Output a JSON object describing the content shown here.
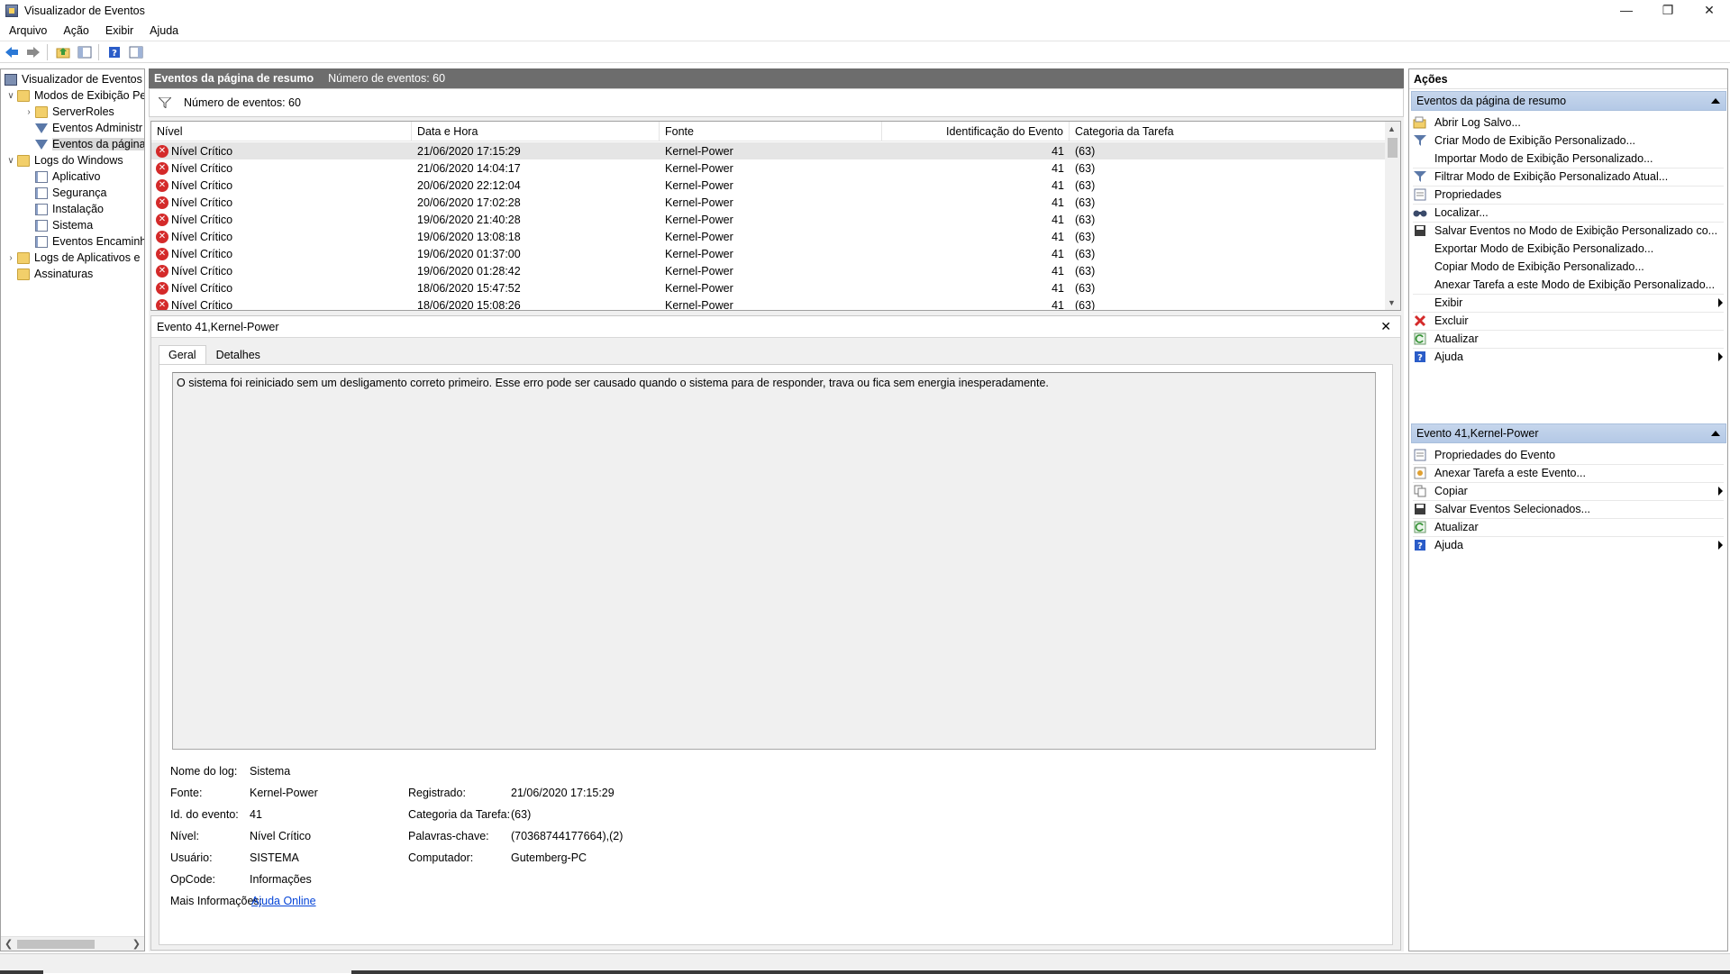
{
  "window": {
    "title": "Visualizador de Eventos",
    "controls": [
      "minimize",
      "restore",
      "close"
    ]
  },
  "menu": [
    "Arquivo",
    "Ação",
    "Exibir",
    "Ajuda"
  ],
  "toolbar": [
    "back-icon",
    "forward-icon",
    "up-folder-icon",
    "show-hide-tree-icon",
    "help-icon",
    "show-hide-action-pane-icon"
  ],
  "tree": {
    "items": [
      {
        "label": "Visualizador de Eventos (L",
        "icon": "viewer-icon"
      },
      {
        "label": "Modos de Exibição Pe",
        "icon": "folder-icon"
      },
      {
        "label": "ServerRoles",
        "icon": "folder-icon"
      },
      {
        "label": "Eventos Administr",
        "icon": "filter-icon"
      },
      {
        "label": "Eventos da página",
        "icon": "filter-icon"
      },
      {
        "label": "Logs do Windows",
        "icon": "folder-icon"
      },
      {
        "label": "Aplicativo",
        "icon": "log-icon"
      },
      {
        "label": "Segurança",
        "icon": "log-icon"
      },
      {
        "label": "Instalação",
        "icon": "log-icon"
      },
      {
        "label": "Sistema",
        "icon": "log-icon"
      },
      {
        "label": "Eventos Encaminh",
        "icon": "log-icon"
      },
      {
        "label": "Logs de Aplicativos e",
        "icon": "folder-icon"
      },
      {
        "label": "Assinaturas",
        "icon": "folder-icon"
      }
    ]
  },
  "summary": {
    "title": "Eventos da página de resumo",
    "count_label": "Número de eventos: 60",
    "filter_count": "Número de eventos: 60"
  },
  "grid": {
    "columns": [
      "Nível",
      "Data e Hora",
      "Fonte",
      "Identificação do Evento",
      "Categoria da Tarefa"
    ],
    "rows": [
      {
        "level": "Nível Crítico",
        "datetime": "21/06/2020 17:15:29",
        "source": "Kernel-Power",
        "id": "41",
        "category": "(63)"
      },
      {
        "level": "Nível Crítico",
        "datetime": "21/06/2020 14:04:17",
        "source": "Kernel-Power",
        "id": "41",
        "category": "(63)"
      },
      {
        "level": "Nível Crítico",
        "datetime": "20/06/2020 22:12:04",
        "source": "Kernel-Power",
        "id": "41",
        "category": "(63)"
      },
      {
        "level": "Nível Crítico",
        "datetime": "20/06/2020 17:02:28",
        "source": "Kernel-Power",
        "id": "41",
        "category": "(63)"
      },
      {
        "level": "Nível Crítico",
        "datetime": "19/06/2020 21:40:28",
        "source": "Kernel-Power",
        "id": "41",
        "category": "(63)"
      },
      {
        "level": "Nível Crítico",
        "datetime": "19/06/2020 13:08:18",
        "source": "Kernel-Power",
        "id": "41",
        "category": "(63)"
      },
      {
        "level": "Nível Crítico",
        "datetime": "19/06/2020 01:37:00",
        "source": "Kernel-Power",
        "id": "41",
        "category": "(63)"
      },
      {
        "level": "Nível Crítico",
        "datetime": "19/06/2020 01:28:42",
        "source": "Kernel-Power",
        "id": "41",
        "category": "(63)"
      },
      {
        "level": "Nível Crítico",
        "datetime": "18/06/2020 15:47:52",
        "source": "Kernel-Power",
        "id": "41",
        "category": "(63)"
      },
      {
        "level": "Nível Crítico",
        "datetime": "18/06/2020 15:08:26",
        "source": "Kernel-Power",
        "id": "41",
        "category": "(63)"
      }
    ]
  },
  "detail": {
    "title": "Evento 41,Kernel-Power",
    "tabs": [
      "Geral",
      "Detalhes"
    ],
    "description": "O sistema foi reiniciado sem um desligamento correto primeiro. Esse erro pode ser causado quando o sistema para de responder, trava ou fica sem energia inesperadamente.",
    "fields": {
      "log_name_label": "Nome do log:",
      "log_name": "Sistema",
      "source_label": "Fonte:",
      "source": "Kernel-Power",
      "event_id_label": "Id. do evento:",
      "event_id": "41",
      "level_label": "Nível:",
      "level": "Nível Crítico",
      "user_label": "Usuário:",
      "user": "SISTEMA",
      "opcode_label": "OpCode:",
      "opcode": "Informações",
      "more_info_label": "Mais Informações:",
      "more_info_link": "Ajuda Online",
      "logged_label": "Registrado:",
      "logged": "21/06/2020 17:15:29",
      "task_category_label": "Categoria da Tarefa:",
      "task_category": "(63)",
      "keywords_label": "Palavras-chave:",
      "keywords": "(70368744177664),(2)",
      "computer_label": "Computador:",
      "computer": "Gutemberg-PC"
    }
  },
  "actions": {
    "title": "Ações",
    "section1": {
      "title": "Eventos da página de resumo",
      "items": [
        {
          "label": "Abrir Log Salvo...",
          "icon": "open-log-icon",
          "submenu": false
        },
        {
          "label": "Criar Modo de Exibição Personalizado...",
          "icon": "filter-icon",
          "submenu": false
        },
        {
          "label": "Importar Modo de Exibição Personalizado...",
          "icon": "",
          "submenu": false
        },
        {
          "label": "Filtrar Modo de Exibição Personalizado Atual...",
          "icon": "filter-icon",
          "submenu": false
        },
        {
          "label": "Propriedades",
          "icon": "properties-icon",
          "submenu": false
        },
        {
          "label": "Localizar...",
          "icon": "find-icon",
          "submenu": false
        },
        {
          "label": "Salvar Eventos no Modo de Exibição Personalizado co...",
          "icon": "save-icon",
          "submenu": false
        },
        {
          "label": "Exportar Modo de Exibição Personalizado...",
          "icon": "",
          "submenu": false
        },
        {
          "label": "Copiar Modo de Exibição Personalizado...",
          "icon": "",
          "submenu": false
        },
        {
          "label": "Anexar Tarefa a este Modo de Exibição Personalizado...",
          "icon": "",
          "submenu": false
        },
        {
          "label": "Exibir",
          "icon": "",
          "submenu": true
        },
        {
          "label": "Excluir",
          "icon": "delete-icon",
          "submenu": false
        },
        {
          "label": "Atualizar",
          "icon": "refresh-icon",
          "submenu": false
        },
        {
          "label": "Ajuda",
          "icon": "help-icon",
          "submenu": true
        }
      ]
    },
    "section2": {
      "title": "Evento 41,Kernel-Power",
      "items": [
        {
          "label": "Propriedades do Evento",
          "icon": "properties-icon",
          "submenu": false
        },
        {
          "label": "Anexar Tarefa a este Evento...",
          "icon": "task-icon",
          "submenu": false
        },
        {
          "label": "Copiar",
          "icon": "copy-icon",
          "submenu": true
        },
        {
          "label": "Salvar Eventos Selecionados...",
          "icon": "save-icon",
          "submenu": false
        },
        {
          "label": "Atualizar",
          "icon": "refresh-icon",
          "submenu": false
        },
        {
          "label": "Ajuda",
          "icon": "help-icon",
          "submenu": true
        }
      ]
    }
  },
  "colors": {
    "critical": "#d42a2a",
    "section_header": "#c6d6ec",
    "summary_header": "#6d6d6d",
    "link": "#0645d8"
  }
}
